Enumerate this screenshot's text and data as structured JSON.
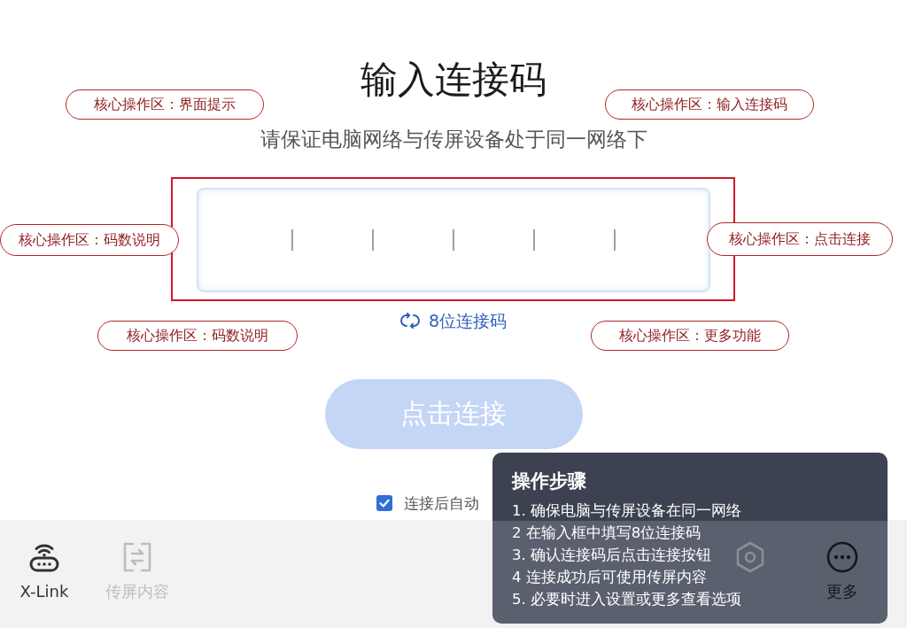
{
  "title": "输入连接码",
  "subtitle": "请保证电脑网络与传屏设备处于同一网络下",
  "code_length_toggle": {
    "label": "8位连接码"
  },
  "connect_button": {
    "label": "点击连接",
    "disabled": true
  },
  "auto_cast": {
    "label": "连接后自动",
    "checked": true
  },
  "toolbar": {
    "items": [
      {
        "label": "X-Link",
        "disabled": false
      },
      {
        "label": "传屏内容",
        "disabled": true
      },
      {
        "disabled": true
      },
      {
        "label": "更多",
        "disabled": false
      }
    ]
  },
  "steps_panel": {
    "title": "操作步骤",
    "steps": [
      "1. 确保电脑与传屏设备在同一网络",
      "2 在输入框中填写8位连接码",
      "3. 确认连接码后点击连接按钮",
      "4 连接成功后可使用传屏内容",
      "5. 必要时进入设置或更多查看选项"
    ]
  },
  "annotations": {
    "callouts": [
      {
        "text": "核心操作区：界面提示"
      },
      {
        "text": "核心操作区：输入连接码"
      },
      {
        "text": "核心操作区：码数说明"
      },
      {
        "text": "核心操作区：点击连接"
      },
      {
        "text": "核心操作区：码数说明"
      },
      {
        "text": "核心操作区：更多功能"
      }
    ]
  }
}
